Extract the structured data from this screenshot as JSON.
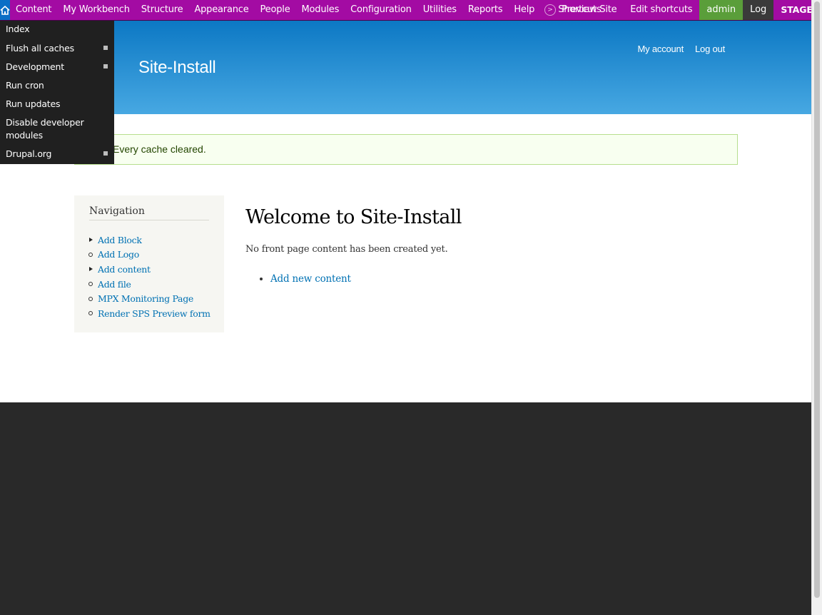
{
  "toolbar": {
    "home_icon": "home-icon",
    "menu": [
      {
        "label": "Content"
      },
      {
        "label": "My Workbench"
      },
      {
        "label": "Structure"
      },
      {
        "label": "Appearance"
      },
      {
        "label": "People"
      },
      {
        "label": "Modules"
      },
      {
        "label": "Configuration"
      },
      {
        "label": "Utilities"
      },
      {
        "label": "Reports"
      },
      {
        "label": "Help"
      }
    ],
    "shortcuts_label": "Shortcuts",
    "preview_label": "Preview Site",
    "edit_shortcuts_label": "Edit shortcuts",
    "user_label": "admin",
    "logout_label": "Log out",
    "server_label": "STAGE SERVER",
    "colors": {
      "bar": "#a30ba3",
      "home": "#0b6fc6",
      "user": "#5a9e3a"
    }
  },
  "dropdown": {
    "items": [
      {
        "label": "Index",
        "has_submenu": false
      },
      {
        "label": "Flush all caches",
        "has_submenu": true
      },
      {
        "label": "Development",
        "has_submenu": true
      },
      {
        "label": "Run cron",
        "has_submenu": false
      },
      {
        "label": "Run updates",
        "has_submenu": false
      },
      {
        "label": "Disable developer modules",
        "has_submenu": false
      },
      {
        "label": "Drupal.org",
        "has_submenu": true
      }
    ]
  },
  "header": {
    "site_name": "Site-Install",
    "my_account": "My account",
    "log_out": "Log out"
  },
  "status": {
    "message": "Every cache cleared."
  },
  "sidebar": {
    "title": "Navigation",
    "items": [
      {
        "label": "Add Block",
        "marker": "expandable"
      },
      {
        "label": "Add Logo",
        "marker": "leaf"
      },
      {
        "label": "Add content",
        "marker": "expandable"
      },
      {
        "label": "Add file",
        "marker": "leaf"
      },
      {
        "label": "MPX Monitoring Page",
        "marker": "leaf"
      },
      {
        "label": "Render SPS Preview form",
        "marker": "leaf"
      }
    ]
  },
  "main": {
    "title": "Welcome to Site-Install",
    "front_text": "No front page content has been created yet.",
    "links": [
      "Add new content"
    ]
  }
}
